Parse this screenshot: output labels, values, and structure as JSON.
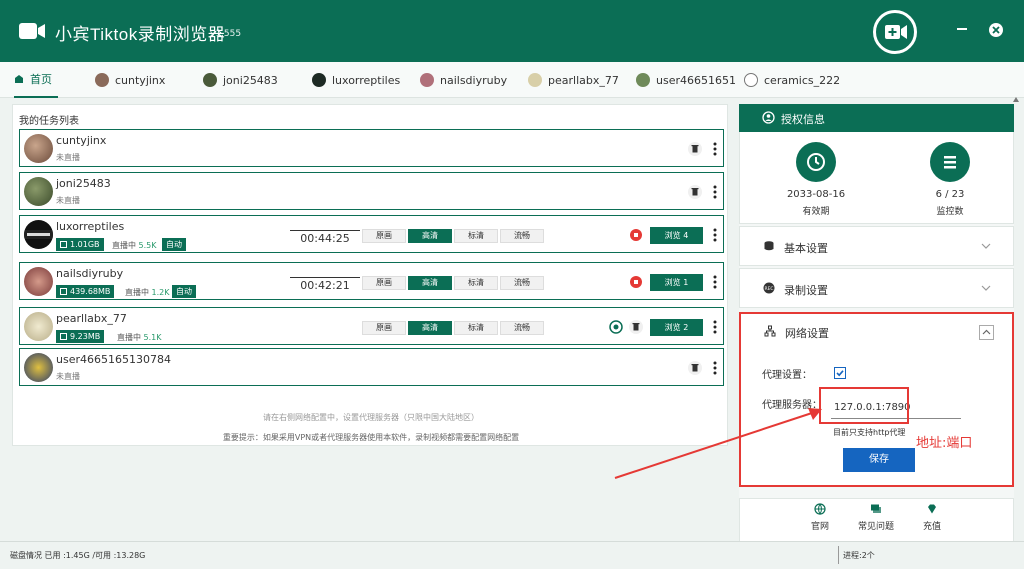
{
  "header": {
    "title": "小宾Tiktok录制浏览器",
    "version": "v1.555",
    "accent": "#0b6e55"
  },
  "tabs": [
    {
      "label": "首页",
      "icon": "home-icon",
      "active": true
    },
    {
      "label": "cuntyjinx"
    },
    {
      "label": "joni25483"
    },
    {
      "label": "luxorreptiles"
    },
    {
      "label": "nailsdiyruby"
    },
    {
      "label": "pearllabx_77"
    },
    {
      "label": "user46651651"
    },
    {
      "label": "ceramics_222"
    }
  ],
  "task_panel": {
    "title": "我的任务列表",
    "rows": [
      {
        "name": "cuntyjinx",
        "status": "未直播"
      },
      {
        "name": "joni25483",
        "status": "未直播"
      },
      {
        "name": "luxorreptiles",
        "size": "1.01GB",
        "live_label": "直播中",
        "viewers": "5.5K",
        "auto": "自动",
        "timer": "00:44:25",
        "qualities": [
          "原画",
          "高清",
          "标清",
          "流畅"
        ],
        "selected": 1,
        "browse": "浏览 4"
      },
      {
        "name": "nailsdiyruby",
        "size": "439.68MB",
        "live_label": "直播中",
        "viewers": "1.2K",
        "auto": "自动",
        "timer": "00:42:21",
        "qualities": [
          "原画",
          "高清",
          "标清",
          "流畅"
        ],
        "selected": 1,
        "browse": "浏览 1"
      },
      {
        "name": "pearllabx_77",
        "size": "9.23MB",
        "live_label": "直播中",
        "viewers": "5.1K",
        "qualities": [
          "原画",
          "高清",
          "标清",
          "流畅"
        ],
        "selected": 1,
        "browse": "浏览 2"
      },
      {
        "name": "user4665165130784",
        "status": "未直播"
      }
    ],
    "hint1": "请在右侧网络配置中，设置代理服务器（只限中国大陆地区）",
    "hint2": "重要提示：如果采用VPN或者代理服务器使用本软件，录制视频都需要配置网络配置"
  },
  "auth": {
    "title": "授权信息",
    "expiry": "2033-08-16",
    "expiry_label": "有效期",
    "monitor": "6 / 23",
    "monitor_label": "监控数"
  },
  "sections": {
    "basic": "基本设置",
    "record": "录制设置",
    "network": "网络设置"
  },
  "network": {
    "proxy_label": "代理设置：",
    "server_label": "代理服务器：",
    "server_value": "127.0.0.1:7890",
    "only_http": "目前只支持http代理",
    "annotation": "地址:端口",
    "save": "保存"
  },
  "bottom_links": [
    "官网",
    "常见问题",
    "充值"
  ],
  "status": {
    "disk": "磁盘情况 已用 :1.45G /可用 :13.28G",
    "process": "进程:2个"
  }
}
